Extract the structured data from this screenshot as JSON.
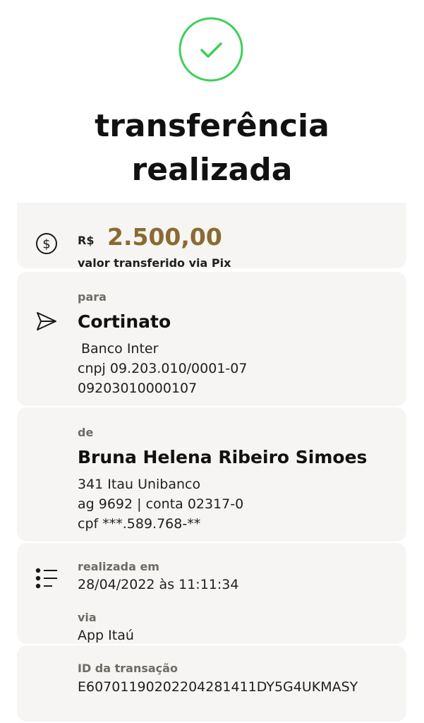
{
  "status": {
    "icon": "checkmark-circle-icon",
    "title_line1": "transferência",
    "title_line2": "realizada",
    "accent_color": "#3fce5a"
  },
  "amount": {
    "icon": "dollar-coin-icon",
    "currency": "R$",
    "value": "2.500,00",
    "description": "valor transferido via Pix",
    "value_color": "#8a6a32"
  },
  "recipient": {
    "icon": "send-icon",
    "label": "para",
    "name": "Cortinato",
    "bank": "Banco Inter",
    "document": "cnpj 09.203.010/0001-07",
    "account": "09203010000107"
  },
  "sender": {
    "label": "de",
    "name": "Bruna Helena Ribeiro Simoes",
    "bank": "341 Itau Unibanco",
    "account": "ag 9692 | conta 02317-0",
    "document": "cpf ***.589.768-**"
  },
  "details": {
    "icon": "list-icon",
    "date_label": "realizada em",
    "date_value": "28/04/2022 às 11:11:34",
    "channel_label": "via",
    "channel_value": "App Itaú"
  },
  "transaction": {
    "id_label": "ID da transação",
    "id_value": "E60701190202204281411DY5G4UKMASY"
  }
}
